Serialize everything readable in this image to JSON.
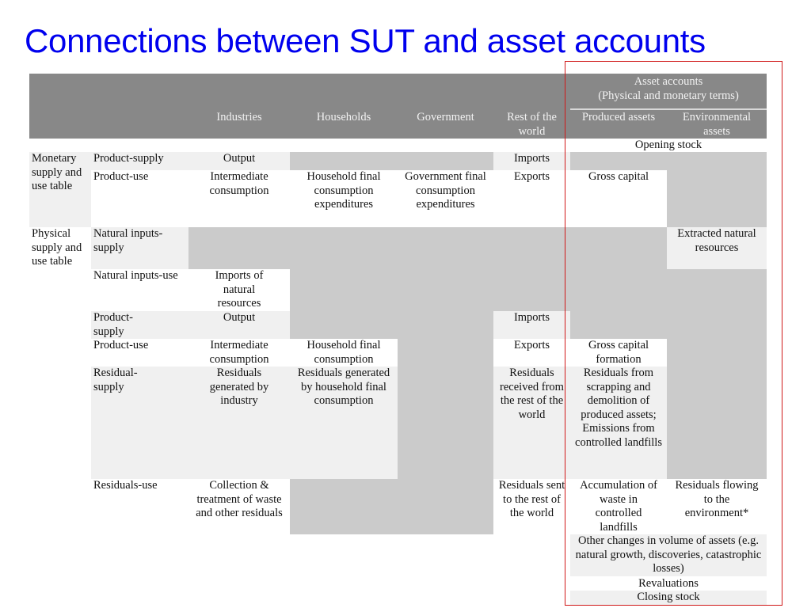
{
  "title": "Connections between SUT and asset accounts",
  "header": {
    "asset_group_line1": "Asset accounts",
    "asset_group_line2": "(Physical and monetary terms)",
    "columns": [
      "Industries",
      "Households",
      "Government",
      "Rest of the world",
      "Produced assets",
      "Environmental assets"
    ]
  },
  "rows": {
    "opening_stock": "Opening stock",
    "monetary_group": "Monetary supply and use table",
    "physical_group": "Physical supply and use table",
    "m_product_supply": {
      "label": "Product-supply",
      "industries": "Output",
      "rest_of_world": "Imports"
    },
    "m_product_use": {
      "label": "Product-use",
      "industries": "Intermediate consumption",
      "households": "Household final consumption expenditures",
      "government": "Government final consumption expenditures",
      "rest_of_world": "Exports",
      "produced_assets": "Gross capital"
    },
    "p_natural_inputs_supply": {
      "label": "Natural inputs-supply",
      "environmental_assets": "Extracted natural resources"
    },
    "p_natural_inputs_use": {
      "label": "Natural inputs-use",
      "industries": "Imports of natural resources"
    },
    "p_product_supply": {
      "label": "Product-supply",
      "industries": "Output",
      "rest_of_world": "Imports"
    },
    "p_product_use": {
      "label": "Product-use",
      "industries": "Intermediate consumption",
      "households": "Household final consumption",
      "rest_of_world": "Exports",
      "produced_assets": "Gross capital formation"
    },
    "p_residual_supply": {
      "label": "Residual-supply",
      "industries": "Residuals generated by industry",
      "households": "Residuals generated by household final consumption",
      "rest_of_world": "Residuals received from the rest of the world",
      "produced_assets": "Residuals from scrapping and demolition of produced assets; Emissions from controlled landfills"
    },
    "p_residuals_use": {
      "label": "Residuals-use",
      "industries": "Collection & treatment of waste and other residuals",
      "rest_of_world": "Residuals sent to the rest of the world",
      "produced_assets": "Accumulation of waste in controlled landfills",
      "environmental_assets": "Residuals flowing to the environment*"
    },
    "other_changes": "Other changes in volume of assets (e.g. natural growth, discoveries, catastrophic losses)",
    "revaluations": "Revaluations",
    "closing_stock": "Closing stock"
  },
  "colors": {
    "title": "#0000ee",
    "header_bg": "#888888",
    "shaded": "#cbcbcb",
    "light": "#f0f0f0",
    "highlight_box": "#d01818"
  }
}
